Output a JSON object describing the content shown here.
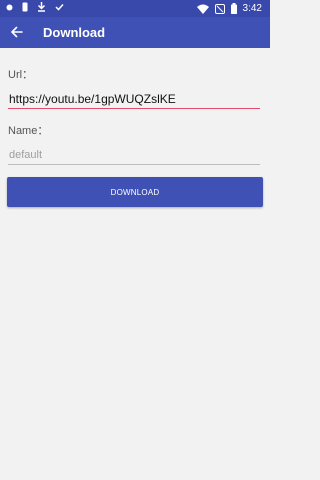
{
  "status_bar": {
    "time": "3:42",
    "icons": [
      "dot-icon",
      "sim-icon",
      "download-icon",
      "check-icon",
      "wifi-icon",
      "mute-icon",
      "battery-icon"
    ]
  },
  "app_bar": {
    "title": "Download",
    "back_icon": "back-arrow-icon"
  },
  "form": {
    "url_label": "Url：",
    "url_value": "https://youtu.be/1gpWUQZslKE",
    "name_label": "Name：",
    "name_placeholder": "default",
    "download_button": "DOWNLOAD"
  },
  "colors": {
    "primary": "#3f51b5",
    "primary_dark": "#3949ab",
    "accent_underline": "#e64a6b",
    "background": "#f2f2f2"
  }
}
